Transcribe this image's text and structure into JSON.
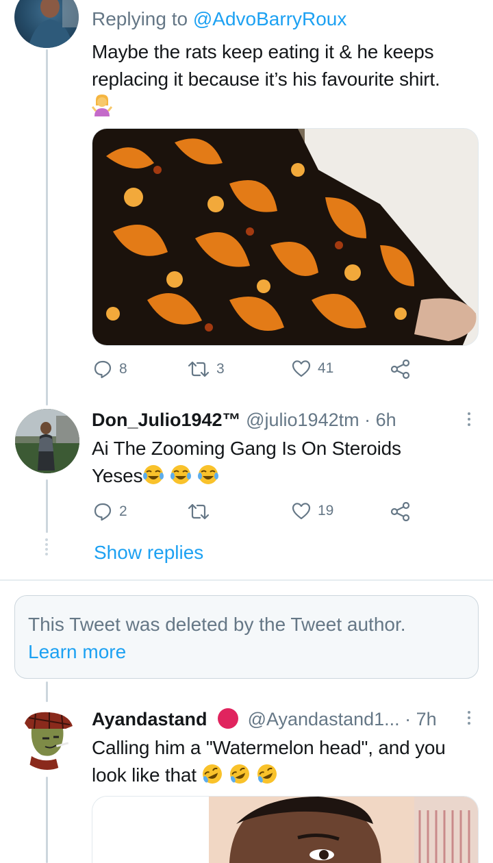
{
  "tweet1": {
    "replying_prefix": "Replying to",
    "replying_handle": "@AdvoBarryRoux",
    "text_line1": "Maybe the rats keep eating it & he keeps",
    "text_line2": "replacing it because it’s his favourite shirt.",
    "emoji": "shrug-woman",
    "media_icon": "patterned-shirt-photo",
    "actions": {
      "reply_count": "8",
      "retweet_count": "3",
      "like_count": "41"
    }
  },
  "tweet2": {
    "display_name": "Don_Julio1942™",
    "handle_time": "@julio1942tm · 6h",
    "text_line1": "Ai The Zooming Gang Is On Steroids",
    "text_line2": "Yeses",
    "emoji": "tears-of-joy",
    "actions": {
      "reply_count": "2",
      "retweet_count": "",
      "like_count": "19"
    },
    "show_replies": "Show replies"
  },
  "deleted_notice": {
    "text": "This Tweet was deleted by the Tweet author.",
    "link": "Learn more"
  },
  "tweet3": {
    "display_name": "Ayandastand",
    "handle_time": "@Ayandastand1... · 7h",
    "text_line1": "Calling him a \"Watermelon head\", and you",
    "text_line2": "look like that",
    "emoji": "rolling-on-floor-laughing",
    "media_icon": "selfie-photo"
  },
  "colors": {
    "accent": "#1da1f2",
    "secondary_text": "#657786",
    "thread_line": "#ccd6dd",
    "verified_badge": "#e0245e"
  }
}
